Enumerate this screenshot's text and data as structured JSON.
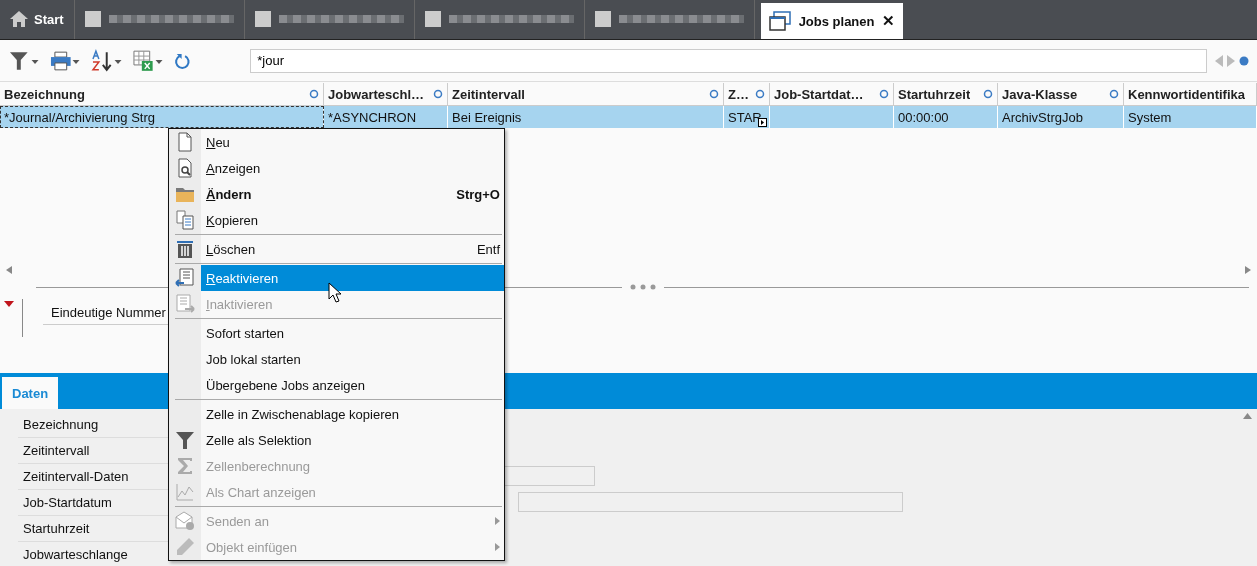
{
  "tabs": [
    {
      "kind": "home",
      "label": "Start",
      "selected": false
    },
    {
      "kind": "blurred",
      "selected": false
    },
    {
      "kind": "blurred",
      "selected": false
    },
    {
      "kind": "blurred",
      "selected": false
    },
    {
      "kind": "blurred",
      "selected": false
    },
    {
      "kind": "window",
      "label": "Jobs planen",
      "selected": true,
      "close": "✕"
    }
  ],
  "search": {
    "value": "*jour"
  },
  "table": {
    "row_selected": true,
    "columns": [
      {
        "label": "Bezeichnung",
        "cell": "*Journal/Archivierung Strg",
        "focused": true
      },
      {
        "label": "Jobwarteschl…",
        "cell": "*ASYNCHRON",
        "focused": false
      },
      {
        "label": "Zeitintervall",
        "cell": "Bei Ereignis",
        "focused": false
      },
      {
        "label": "Z…",
        "cell": "STAR",
        "focused": false,
        "expander": true
      },
      {
        "label": "Job-Startdat…",
        "focused": false
      },
      {
        "label": "Startuhrzeit",
        "cell": "00:00:00",
        "focused": false
      },
      {
        "label": "Java-Klasse",
        "cell": "ArchivStrgJob",
        "focused": false
      },
      {
        "label": "Kennwortidentifika",
        "cell": "System",
        "focused": false
      }
    ]
  },
  "detail_filter": {
    "label": "Eindeutige Nummer"
  },
  "detail_tabs": [
    {
      "label": "Daten",
      "selected": true
    }
  ],
  "form": {
    "fields": [
      {
        "label": "Bezeichnung"
      },
      {
        "label": "Zeitintervall"
      },
      {
        "label": "Zeitintervall-Daten"
      },
      {
        "label": "Job-Startdatum"
      },
      {
        "label": "Startuhrzeit"
      },
      {
        "label": "Jobwarteschlange"
      }
    ]
  },
  "context_menu": {
    "items": [
      {
        "kind": "item",
        "label": "Neu",
        "mnemonic": true,
        "disabled": false,
        "selected": false
      },
      {
        "kind": "item",
        "label": "Anzeigen",
        "mnemonic": true,
        "disabled": false,
        "selected": false
      },
      {
        "kind": "item",
        "label": "Ändern",
        "mnemonic": true,
        "bold": true,
        "shortcut": "Strg+O",
        "disabled": false,
        "selected": false
      },
      {
        "kind": "item",
        "label": "Kopieren",
        "mnemonic": true,
        "disabled": false,
        "selected": false
      },
      {
        "kind": "separator"
      },
      {
        "kind": "item",
        "label": "Löschen",
        "mnemonic": true,
        "shortcut": "Entf",
        "disabled": false,
        "selected": false
      },
      {
        "kind": "separator"
      },
      {
        "kind": "item",
        "label": "Reaktivieren",
        "mnemonic": true,
        "disabled": false,
        "selected": true
      },
      {
        "kind": "item",
        "label": "Inaktivieren",
        "mnemonic": true,
        "disabled": true,
        "selected": false
      },
      {
        "kind": "separator"
      },
      {
        "kind": "item",
        "label": "Sofort starten",
        "disabled": false,
        "selected": false
      },
      {
        "kind": "item",
        "label": "Job lokal starten",
        "disabled": false,
        "selected": false
      },
      {
        "kind": "item",
        "label": "Übergebene Jobs anzeigen",
        "disabled": false,
        "selected": false
      },
      {
        "kind": "separator"
      },
      {
        "kind": "item",
        "label": "Zelle in Zwischenablage kopieren",
        "disabled": false,
        "selected": false
      },
      {
        "kind": "item",
        "label": "Zelle als Selektion",
        "disabled": false,
        "selected": false
      },
      {
        "kind": "item",
        "label": "Zellenberechnung",
        "disabled": true,
        "selected": false
      },
      {
        "kind": "item",
        "label": "Als Chart anzeigen",
        "disabled": true,
        "selected": false
      },
      {
        "kind": "separator"
      },
      {
        "kind": "item",
        "label": "Senden an",
        "disabled": true,
        "selected": false,
        "submenu": true
      },
      {
        "kind": "item",
        "label": "Objekt einfügen",
        "disabled": true,
        "selected": false,
        "submenu": true
      }
    ]
  }
}
